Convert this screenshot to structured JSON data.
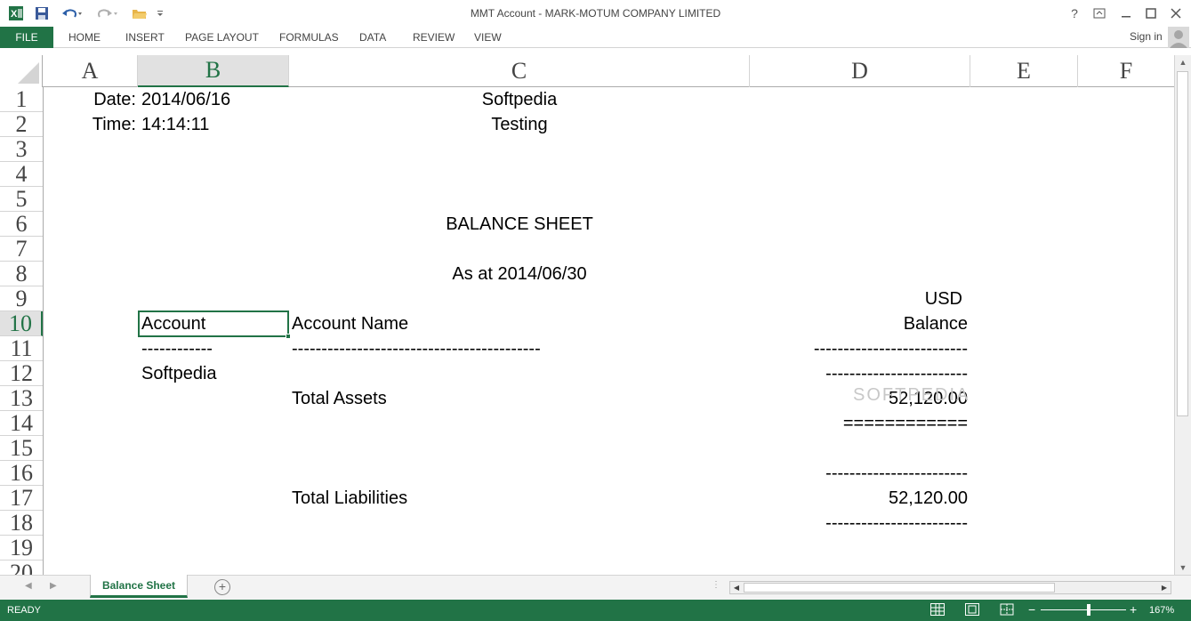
{
  "app": {
    "title": "MMT Account - MARK-MOTUM COMPANY LIMITED",
    "icon": "excel-icon",
    "brand_color": "#217346"
  },
  "quick_access": {
    "icons": [
      "excel-logo-icon",
      "save-icon",
      "undo-icon",
      "redo-icon",
      "open-folder-icon",
      "customize-toolbar-icon"
    ]
  },
  "window_controls": {
    "help": "?",
    "icons": [
      "help-icon",
      "ribbon-display-icon",
      "minimize-icon",
      "maximize-icon",
      "close-icon"
    ]
  },
  "ribbon": {
    "file": "FILE",
    "tabs": [
      "HOME",
      "INSERT",
      "PAGE LAYOUT",
      "FORMULAS",
      "DATA",
      "REVIEW",
      "VIEW"
    ],
    "signin": "Sign in"
  },
  "columns": [
    "A",
    "B",
    "C",
    "D",
    "E",
    "F"
  ],
  "selected_column": "B",
  "rows": [
    "1",
    "2",
    "3",
    "4",
    "5",
    "6",
    "7",
    "8",
    "9",
    "10",
    "11",
    "12",
    "13",
    "14",
    "15",
    "16",
    "17",
    "18",
    "19",
    "20"
  ],
  "selected_row": "10",
  "sheet": {
    "date_label": "Date:",
    "date_value": "2014/06/16",
    "time_label": "Time:",
    "time_value": "14:14:11",
    "company": "Softpedia",
    "subtitle": "Testing",
    "report_title": "BALANCE SHEET",
    "as_at": "As at  2014/06/30",
    "currency": "USD",
    "header_account": "Account",
    "header_account_name": "Account Name",
    "header_balance": "Balance",
    "rule_account": "------------",
    "rule_name": "------------------------------------------",
    "rule_balance": "--------------------------",
    "row12_account": "Softpedia",
    "rule_balance_2": "------------------------",
    "total_assets_label": "Total Assets",
    "total_assets_value": "52,120.00",
    "double_rule": "============",
    "rule_balance_3": "------------------------",
    "total_liabilities_label": "Total Liabilities",
    "total_liabilities_value": "52,120.00",
    "rule_balance_4": "------------------------"
  },
  "watermark": "SOFTPEDIA",
  "sheet_tabs": {
    "active": "Balance Sheet",
    "add_icon": "plus-circle-icon"
  },
  "status": {
    "ready": "READY",
    "view_icons": [
      "normal-view-icon",
      "page-layout-view-icon",
      "page-break-view-icon"
    ],
    "zoom_minus": "−",
    "zoom_plus": "+",
    "zoom": "167%",
    "zoom_fraction": 0.55
  }
}
